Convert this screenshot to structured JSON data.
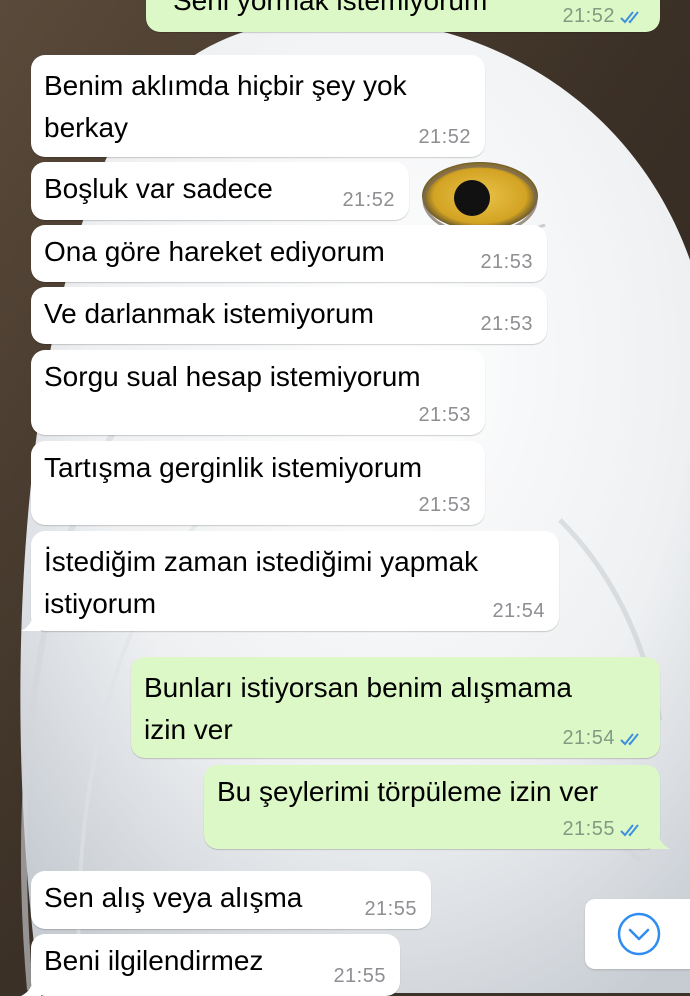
{
  "colors": {
    "incoming_bubble": "#ffffff",
    "outgoing_bubble": "#dcf8c6",
    "read_ticks": "#3d8fe0",
    "timestamp": "#8e8e93"
  },
  "messages": [
    {
      "id": "m0",
      "direction": "outgoing",
      "text": "Seni yormak istemiyorum",
      "time": "21:52",
      "status": "read"
    },
    {
      "id": "m1",
      "direction": "incoming",
      "text": "Benim aklımda hiçbir şey yok\nberkay",
      "time": "21:52"
    },
    {
      "id": "m2",
      "direction": "incoming",
      "text": "Boşluk var sadece",
      "time": "21:52"
    },
    {
      "id": "m3",
      "direction": "incoming",
      "text": "Ona göre hareket ediyorum",
      "time": "21:53"
    },
    {
      "id": "m4",
      "direction": "incoming",
      "text": "Ve darlanmak istemiyorum",
      "time": "21:53"
    },
    {
      "id": "m5",
      "direction": "incoming",
      "text": "Sorgu sual hesap istemiyorum",
      "time": "21:53"
    },
    {
      "id": "m6",
      "direction": "incoming",
      "text": "Tartışma gerginlik istemiyorum",
      "time": "21:53"
    },
    {
      "id": "m7",
      "direction": "incoming",
      "text": "İstediğim zaman istediğimi yapmak\nistiyorum",
      "time": "21:54"
    },
    {
      "id": "m8",
      "direction": "outgoing",
      "text": "Bunları istiyorsan benim alışmama\nizin ver",
      "time": "21:54",
      "status": "read"
    },
    {
      "id": "m9",
      "direction": "outgoing",
      "text": "Bu şeylerimi törpüleme izin ver",
      "time": "21:55",
      "status": "read"
    },
    {
      "id": "m10",
      "direction": "incoming",
      "text": "Sen alış veya alışma",
      "time": "21:55"
    },
    {
      "id": "m11",
      "direction": "incoming",
      "text": "Beni ilgilendirmez",
      "time": "21:55"
    }
  ],
  "wallpaper": {
    "subject": "snowy owl"
  },
  "controls": {
    "scroll_down_icon": "chevron-down-circle-icon"
  }
}
